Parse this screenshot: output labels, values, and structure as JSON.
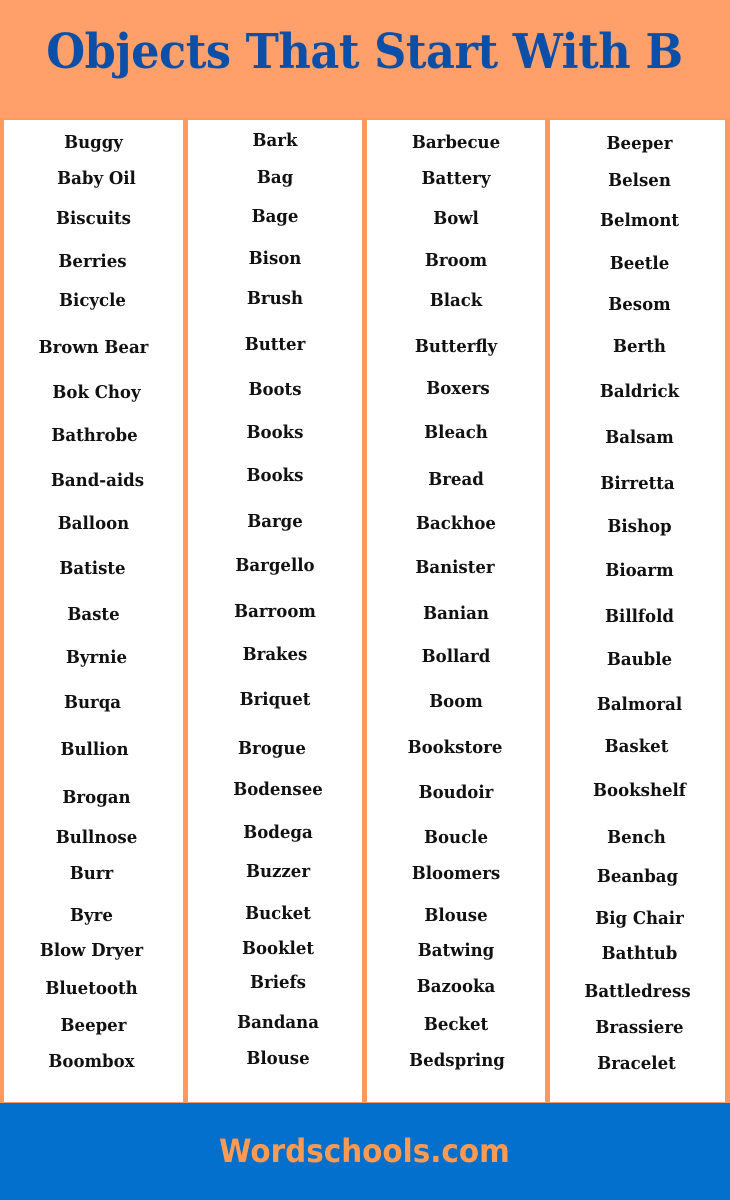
{
  "header": {
    "title": "Objects That Start With B"
  },
  "columns": [
    {
      "words": [
        "Buggy",
        "Baby Oil",
        "Biscuits",
        "Berries",
        "Bicycle",
        "Brown Bear",
        "Bok Choy",
        "Bathrobe",
        "Band-aids",
        "Balloon",
        "Batiste",
        "Baste",
        "Byrnie",
        "Burqa",
        "Bullion",
        "Brogan",
        "Bullnose",
        "Burr",
        "Byre",
        "Blow Dryer",
        "Bluetooth",
        "Beeper",
        "Boombox"
      ]
    },
    {
      "words": [
        "Bark",
        "Bag",
        "Bage",
        "Bison",
        "Brush",
        "Butter",
        "Boots",
        "Books",
        "Books",
        "Barge",
        "Bargello",
        "Barroom",
        "Brakes",
        "Briquet",
        "Brogue",
        "Bodensee",
        "Bodega",
        "Buzzer",
        "Bucket",
        "Booklet",
        "Briefs",
        "Bandana",
        "Blouse"
      ]
    },
    {
      "words": [
        "Barbecue",
        "Battery",
        "Bowl",
        "Broom",
        "Black",
        "Butterfly",
        "Boxers",
        "Bleach",
        "Bread",
        "Backhoe",
        "Banister",
        "Banian",
        "Bollard",
        "Boom",
        "Bookstore",
        "Boudoir",
        "Boucle",
        "Bloomers",
        "Blouse",
        "Batwing",
        "Bazooka",
        "Becket",
        "Bedspring"
      ]
    },
    {
      "words": [
        "Beeper",
        "Belsen",
        "Belmont",
        "Beetle",
        "Besom",
        "Berth",
        "Baldrick",
        "Balsam",
        "Birretta",
        "Bishop",
        "Bioarm",
        "Billfold",
        "Bauble",
        "Balmoral",
        "Basket",
        "Bookshelf",
        "Bench",
        "Beanbag",
        "Big Chair",
        "Bathtub",
        "Battledress",
        "Brassiere",
        "Bracelet"
      ]
    }
  ],
  "footer": {
    "text": "Wordschools.com"
  },
  "colors": {
    "header_bg": "#ffa06a",
    "title": "#0b4fa8",
    "divider": "#ff9a5c",
    "footer_bg": "#0270cc",
    "footer_text": "#ff9a50"
  }
}
